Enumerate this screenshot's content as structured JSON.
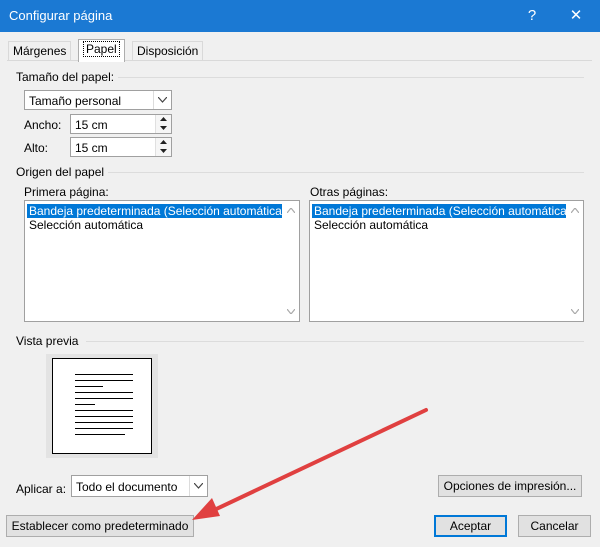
{
  "window": {
    "title": "Configurar página",
    "help_glyph": "?",
    "close_glyph": "✕"
  },
  "tabs": [
    {
      "label": "Márgenes",
      "active": false
    },
    {
      "label": "Papel",
      "active": true
    },
    {
      "label": "Disposición",
      "active": false
    }
  ],
  "paper_size": {
    "group_label": "Tamaño del papel:",
    "selected": "Tamaño personal",
    "width_label": "Ancho:",
    "width_value": "15 cm",
    "height_label": "Alto:",
    "height_value": "15 cm"
  },
  "paper_source": {
    "group_label": "Origen del papel",
    "first_page_label": "Primera página:",
    "other_pages_label": "Otras páginas:",
    "first_page_items": [
      "Bandeja predeterminada (Selección automática)",
      "Selección automática"
    ],
    "other_pages_items": [
      "Bandeja predeterminada (Selección automática)",
      "Selección automática"
    ],
    "selected_index": 0
  },
  "preview": {
    "group_label": "Vista previa"
  },
  "apply_to": {
    "label": "Aplicar a:",
    "selected": "Todo el documento"
  },
  "buttons": {
    "print_options": "Opciones de impresión...",
    "set_default": "Establecer como predeterminado",
    "ok": "Aceptar",
    "cancel": "Cancelar"
  },
  "colors": {
    "titlebar": "#1b79d3",
    "selection": "#0078d7",
    "annotation_arrow": "#e04040"
  },
  "annotation": {
    "type": "red-arrow",
    "points_to": "set_default_button"
  }
}
